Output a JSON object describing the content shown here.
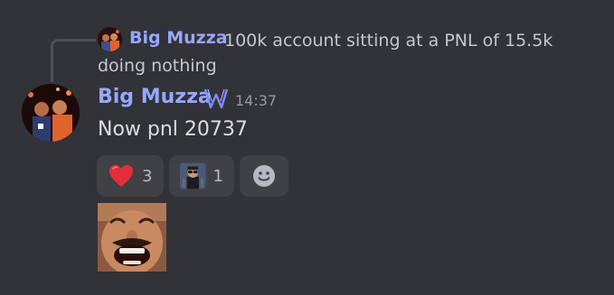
{
  "reply": {
    "author": "Big Muzza",
    "text_line1": "100k account sitting at a PNL of 15.5k",
    "text_line2": "doing nothing"
  },
  "message": {
    "author": "Big Muzza",
    "timestamp": "14:37",
    "content": "Now pnl 20737",
    "role_icon": "w-badge-icon"
  },
  "reactions": [
    {
      "emoji": "red-heart-icon",
      "count": "3"
    },
    {
      "emoji": "custom-sunglasses-man-icon",
      "count": "1"
    }
  ],
  "add_reaction": {
    "icon": "add-reaction-smiley-icon"
  },
  "colors": {
    "background": "#313338",
    "username": "#97a7ff",
    "reaction_bg": "#3f4147",
    "text": "#dbdee1",
    "muted": "#949ba4"
  }
}
